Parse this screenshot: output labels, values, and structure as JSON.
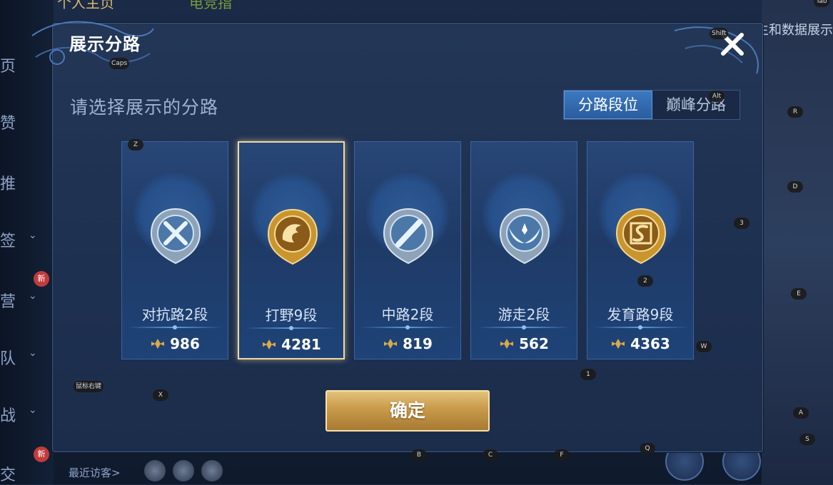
{
  "background": {
    "top_left_text": "个人主页",
    "top_mid_text": "电竞指",
    "right_text": "主和数据展示",
    "sidebar_items": [
      {
        "label": "页",
        "chevron": false
      },
      {
        "label": "赞",
        "chevron": false
      },
      {
        "label": "推",
        "chevron": false
      },
      {
        "label": "签",
        "chevron": true
      },
      {
        "label": "营",
        "chevron": true,
        "badge": "新"
      },
      {
        "label": "队",
        "chevron": true
      },
      {
        "label": "战",
        "chevron": true
      },
      {
        "label": "交",
        "chevron": false,
        "badge": "新"
      }
    ],
    "recent_visitors_label": "最近访客>"
  },
  "dialog": {
    "title": "展示分路",
    "subtitle": "请选择展示的分路",
    "tabs": [
      {
        "label": "分路段位",
        "active": true
      },
      {
        "label": "巅峰分路",
        "active": false
      }
    ],
    "cards": [
      {
        "lane": "对抗路2段",
        "score": "986",
        "emblem": "silver-crossed-swords-icon",
        "tier": "silver",
        "selected": false
      },
      {
        "lane": "打野9段",
        "score": "4281",
        "emblem": "gold-dragon-icon",
        "tier": "gold",
        "selected": true
      },
      {
        "lane": "中路2段",
        "score": "819",
        "emblem": "silver-slash-icon",
        "tier": "silver",
        "selected": false
      },
      {
        "lane": "游走2段",
        "score": "562",
        "emblem": "silver-wings-icon",
        "tier": "silver",
        "selected": false
      },
      {
        "lane": "发育路9段",
        "score": "4363",
        "emblem": "gold-s-icon",
        "tier": "gold",
        "selected": true
      }
    ],
    "confirm_label": "确定"
  },
  "key_hints": [
    {
      "label": "Caps"
    },
    {
      "label": "Shift"
    },
    {
      "label": "Alt"
    },
    {
      "label": "Tab"
    },
    {
      "label": "Z"
    },
    {
      "label": "R"
    },
    {
      "label": "D"
    },
    {
      "label": "3"
    },
    {
      "label": "2"
    },
    {
      "label": "E"
    },
    {
      "label": "W"
    },
    {
      "label": "1"
    },
    {
      "label": "鼠标右键"
    },
    {
      "label": "X"
    },
    {
      "label": "A"
    },
    {
      "label": "S"
    },
    {
      "label": "B"
    },
    {
      "label": "C"
    },
    {
      "label": "F"
    },
    {
      "label": "Q"
    }
  ],
  "colors": {
    "gold": "#d9a94a",
    "silver": "#b9c9dc",
    "selected_border": "#f2d9a2",
    "tab_active": "#2f69b0"
  }
}
